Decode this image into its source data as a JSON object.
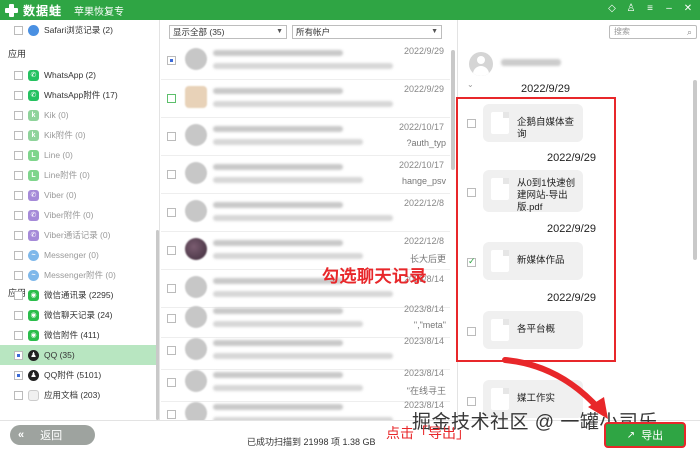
{
  "titlebar": {
    "app_name": "数据蛙",
    "subtitle": "苹果恢复专"
  },
  "sidebar": {
    "section_label": "应用",
    "section_label_2": "应用",
    "items": [
      {
        "label": "Safari浏览记录 (2)",
        "icon": "safari-icon"
      },
      {
        "label": "WhatsApp (2)",
        "icon": "whatsapp-icon"
      },
      {
        "label": "WhatsApp附件 (17)",
        "icon": "whatsapp-icon"
      },
      {
        "label": "Kik (0)",
        "icon": "kik-icon"
      },
      {
        "label": "Kik附件 (0)",
        "icon": "kik-icon"
      },
      {
        "label": "Line (0)",
        "icon": "line-icon"
      },
      {
        "label": "Line附件 (0)",
        "icon": "line-icon"
      },
      {
        "label": "Viber (0)",
        "icon": "viber-icon"
      },
      {
        "label": "Viber附件 (0)",
        "icon": "viber-icon"
      },
      {
        "label": "Viber通话记录 (0)",
        "icon": "viber-icon"
      },
      {
        "label": "Messenger (0)",
        "icon": "messenger-icon"
      },
      {
        "label": "Messenger附件 (0)",
        "icon": "messenger-icon"
      },
      {
        "label": "微信通讯录 (2295)",
        "icon": "wechat-icon"
      },
      {
        "label": "微信聊天记录 (24)",
        "icon": "wechat-icon"
      },
      {
        "label": "微信附件 (411)",
        "icon": "wechat-icon"
      },
      {
        "label": "QQ (35)",
        "icon": "qq-icon"
      },
      {
        "label": "QQ附件 (5101)",
        "icon": "qq-icon"
      },
      {
        "label": "应用文档 (203)",
        "icon": "document-icon"
      }
    ]
  },
  "middle": {
    "filter_display": "显示全部 (35)",
    "filter_account": "所有帐户",
    "rows": [
      {
        "date": "2022/9/29",
        "snippet": ""
      },
      {
        "date": "2022/9/29",
        "snippet": ""
      },
      {
        "date": "2022/10/17",
        "snippet": "?auth_typ"
      },
      {
        "date": "2022/10/17",
        "snippet": "hange_psv"
      },
      {
        "date": "2022/12/8",
        "snippet": ""
      },
      {
        "date": "2022/12/8",
        "snippet": "长大后更"
      },
      {
        "date": "2023/8/14",
        "snippet": ""
      },
      {
        "date": "2023/8/14",
        "snippet": "\",\"meta\""
      },
      {
        "date": "2023/8/14",
        "snippet": ""
      },
      {
        "date": "2023/8/14",
        "snippet": "\"在线寻王"
      },
      {
        "date": "2023/8/14",
        "snippet": ""
      }
    ]
  },
  "annotation_check": "勾选聊天记录",
  "right": {
    "search_placeholder": "搜索",
    "messages": [
      {
        "date": "2022/9/29",
        "title": "企鹅自媒体查询",
        "checked": false
      },
      {
        "date": "2022/9/29",
        "title": "从0到1快速创建网站-导出版.pdf",
        "checked": false
      },
      {
        "date": "2022/9/29",
        "title": "新媒体作品",
        "checked": true
      },
      {
        "date": "2022/9/29",
        "title": "各平台概",
        "checked": false
      },
      {
        "date": "",
        "title": "媒工作实",
        "checked": false
      }
    ]
  },
  "bottom": {
    "back_label": "返回",
    "status": "已成功扫描到 21998 项 1.38 GB",
    "export_label": "导出",
    "annotation_export": "点击「导出」",
    "watermark": "掘金技术社区 @ 一罐小司乐"
  },
  "colors": {
    "brand_green": "#2fa544",
    "annotation_red": "#e8272a",
    "selected_row": "#b8e6c1"
  }
}
